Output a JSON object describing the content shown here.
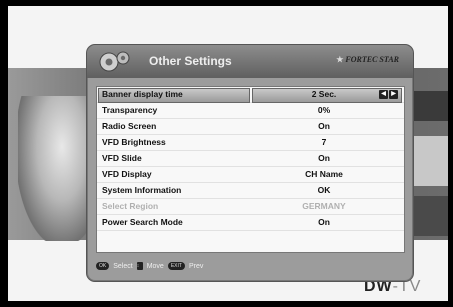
{
  "menu": {
    "title": "Other Settings",
    "brand": "FORTEC STAR",
    "rows": [
      {
        "label": "Banner display time",
        "value": "2 Sec."
      },
      {
        "label": "Transparency",
        "value": "0%"
      },
      {
        "label": "Radio Screen",
        "value": "On"
      },
      {
        "label": "VFD Brightness",
        "value": "7"
      },
      {
        "label": "VFD Slide",
        "value": "On"
      },
      {
        "label": "VFD Display",
        "value": "CH Name"
      },
      {
        "label": "System Information",
        "value": "OK"
      },
      {
        "label": "Select Region",
        "value": "GERMANY"
      },
      {
        "label": "Power Search Mode",
        "value": "On"
      }
    ],
    "selected_row": 0,
    "disabled_row": 7
  },
  "footer": {
    "select_key": "OK",
    "select_label": "Select",
    "move_label": "Move",
    "prev_key": "EXIT",
    "prev_label": "Prev"
  },
  "channel_logo": {
    "main": "DW",
    "suffix": "-TV"
  },
  "colors": {
    "panel": "#9c9c9c",
    "list_bg": "#f8f8f8",
    "selected": "#a8a8a8"
  }
}
